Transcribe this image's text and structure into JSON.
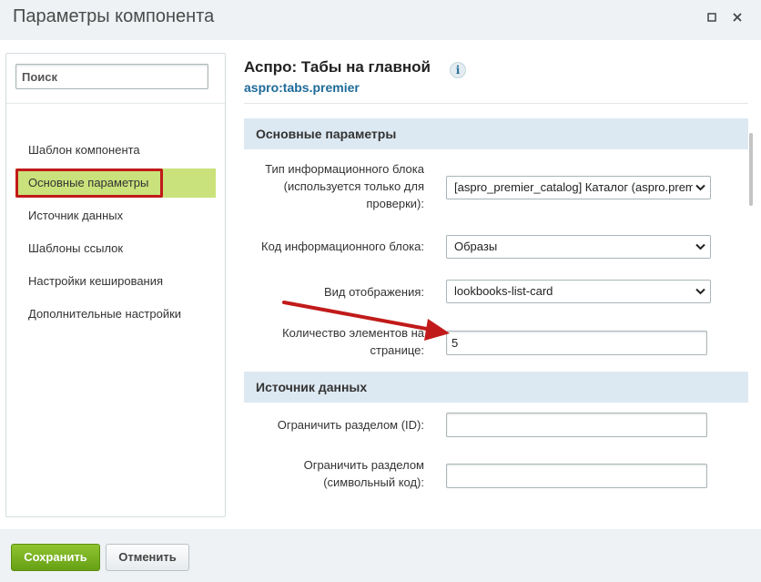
{
  "window": {
    "title": "Параметры компонента"
  },
  "sidebar": {
    "search_placeholder": "Поиск",
    "items": [
      {
        "label": "Шаблон компонента"
      },
      {
        "label": "Основные параметры",
        "active": true
      },
      {
        "label": "Источник данных"
      },
      {
        "label": "Шаблоны ссылок"
      },
      {
        "label": "Настройки кеширования"
      },
      {
        "label": "Дополнительные настройки"
      }
    ]
  },
  "component": {
    "title": "Аспро: Табы на главной",
    "code": "aspro:tabs.premier",
    "info_icon_text": "i"
  },
  "sections": {
    "main": {
      "title": "Основные параметры",
      "fields": {
        "iblock_type": {
          "label_line1": "Тип информационного блока",
          "label_line2": "(используется только для",
          "label_line3": "проверки):",
          "value": "[aspro_premier_catalog] Каталог (aspro.premier_catalog)"
        },
        "iblock_code": {
          "label": "Код информационного блока:",
          "value": "Образы"
        },
        "view": {
          "label": "Вид отображения:",
          "value": "lookbooks-list-card"
        },
        "count": {
          "label_line1": "Количество элементов на",
          "label_line2": "странице:",
          "value": "5"
        }
      }
    },
    "source": {
      "title": "Источник данных",
      "fields": {
        "section_id": {
          "label": "Ограничить разделом (ID):",
          "value": ""
        },
        "section_code": {
          "label_line1": "Ограничить разделом",
          "label_line2": "(символьный код):",
          "value": ""
        }
      }
    }
  },
  "footer": {
    "save_label": "Сохранить",
    "cancel_label": "Отменить"
  },
  "colors": {
    "accent_green": "#8fc431",
    "highlight_red": "#c11a1a",
    "section_bg": "#dde9f2",
    "link_blue": "#1e6a98"
  }
}
